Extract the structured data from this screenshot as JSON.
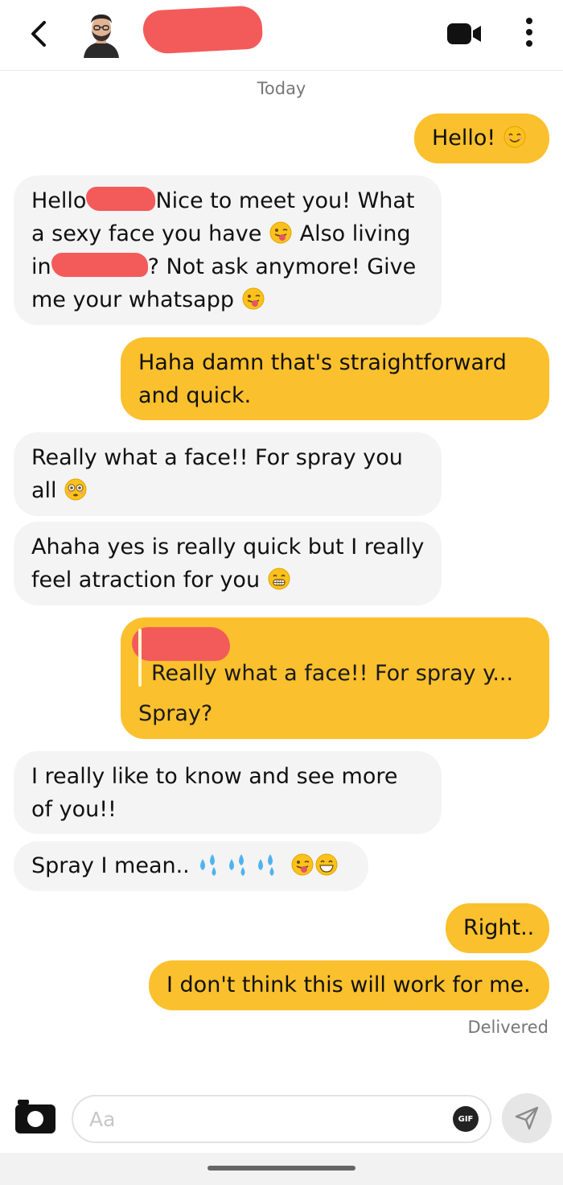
{
  "header": {
    "back_icon": "chevron-left-icon",
    "video_icon": "video-camera-icon",
    "more_icon": "more-vertical-icon"
  },
  "date_label": "Today",
  "messages": {
    "m1": "Hello!",
    "m2": {
      "a": "Hello",
      "b": "Nice to meet you! What",
      "c": "a sexy face you have",
      "d": "Also living",
      "e": "in",
      "f": "? Not ask anymore! Give",
      "g": "me your whatsapp"
    },
    "m3": {
      "a": "Haha damn that's straightforward",
      "b": "and quick."
    },
    "m4": {
      "a": "Really what a face!! For spray you",
      "b": "all"
    },
    "m5": {
      "a": "Ahaha yes is really quick but I really",
      "b": "feel atraction for you"
    },
    "m6": {
      "quote": "Really what a face!! For spray y...",
      "reply": "Spray?"
    },
    "m7": {
      "a": "I really like to know and see more",
      "b": "of you!!"
    },
    "m8": "Spray I mean..",
    "m9": "Right..",
    "m10": "I don't think this will work for me."
  },
  "status": "Delivered",
  "composer": {
    "placeholder": "Aa",
    "gif_label": "GIF",
    "camera_icon": "camera-icon",
    "send_icon": "send-icon"
  },
  "colors": {
    "outgoing_bubble": "#fbc02d",
    "incoming_bubble": "#f4f4f4",
    "redaction": "#f35b5b"
  }
}
